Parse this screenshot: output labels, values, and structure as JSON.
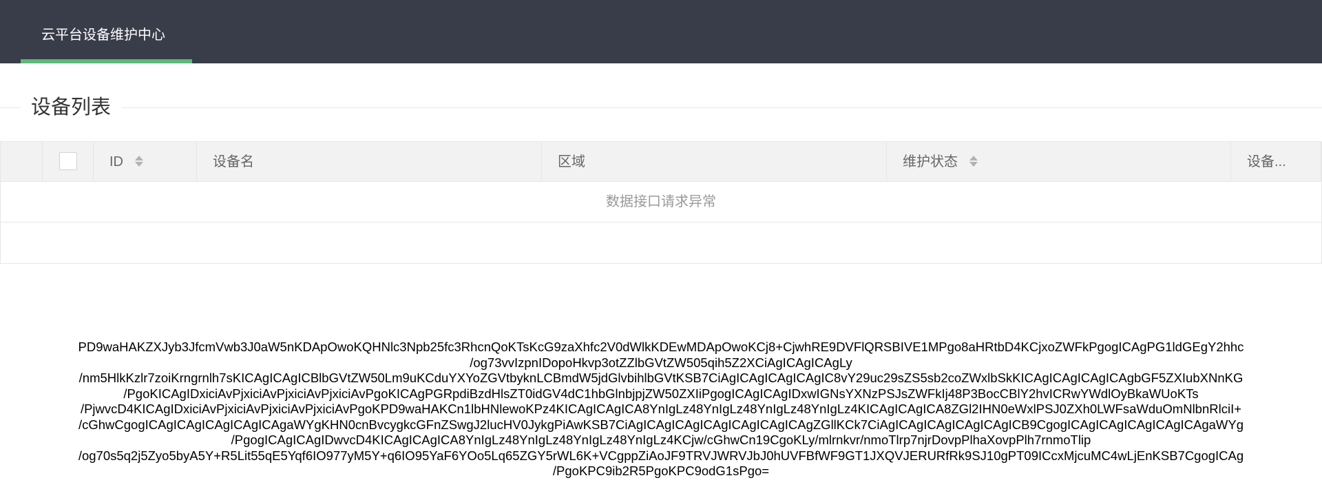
{
  "header": {
    "nav_title": "云平台设备维护中心",
    "accent_color": "#5fb878",
    "background_color": "#393d49"
  },
  "section": {
    "title": "设备列表"
  },
  "table": {
    "columns": [
      {
        "label": "",
        "type": "checkbox"
      },
      {
        "label": "ID",
        "sortable": true
      },
      {
        "label": "设备名",
        "sortable": false
      },
      {
        "label": "区域",
        "sortable": false
      },
      {
        "label": "维护状态",
        "sortable": true
      },
      {
        "label": "设备...",
        "sortable": false
      }
    ],
    "empty_message": "数据接口请求异常"
  },
  "payload_lines": [
    "PD9waHAKZXJyb3JfcmVwb3J0aW5nKDApOwoKQHNlc3Npb25fc3RhcnQoKTsKcG9zaXhfc2V0dWlkKDEwMDApOwoKCj8+CjwhRE9DVFlQRSBIVE1MPgo8aHRtbD4KCjxoZWFkPgogICAgPG1ldGEgY2hhc",
    "/og73vvIzpnIDopoHkvp3otZZlbGVtZW505qih5Z2XCiAgICAgICAgLy",
    "/nm5HlkKzlr7zoiKrngrnlh7sKICAgICAgICBlbGVtZW50Lm9uKCduYXYoZGVtbyknLCBmdW5jdGlvbihlbGVtKSB7CiAgICAgICAgICAgIC8vY29uc29sZS5sb2coZWxlbSkKICAgICAgICAgICAgbGF5ZXIubXNnKG",
    "/PgoKICAgIDxiciAvPjxiciAvPjxiciAvPjxiciAvPgoKICAgPGRpdiBzdHlsZT0idGV4dC1hbGlnbjpjZW50ZXIiPgogICAgICAgIDxwIGNsYXNzPSJsZWFkIj48P3BocCBlY2hvICRwYWdlOyBkaWUoKTs",
    "/PjwvcD4KICAgIDxiciAvPjxiciAvPjxiciAvPjxiciAvPgoKPD9waHAKCn1lbHNlewoKPz4KICAgICAgICA8YnIgLz48YnIgLz48YnIgLz48YnIgLz4KICAgICAgICA8ZGl2IHN0eWxlPSJ0ZXh0LWFsaWduOmNlbnRlciI+",
    "/cGhwCgogICAgICAgICAgICAgICAgaWYgKHN0cnBvcygkcGFnZSwgJ2lucHV0JykgPiAwKSB7CiAgICAgICAgICAgICAgICAgICAgZGllKCk7CiAgICAgICAgICAgICAgICB9CgogICAgICAgICAgICAgICAgaWYg",
    "/PgogICAgICAgIDwvcD4KICAgICAgICA8YnIgLz48YnIgLz48YnIgLz48YnIgLz4KCjw/cGhwCn19CgoKLy/mlrnkvr/nmoTlrp7njrDovpPlhaXovpPlh7rnmoTlip",
    "/og70s5q2j5Zyo5byA5Y+R5Lit55qE5Yqf6IO977yM5Y+q6IO95YaF6YOo5Lq65ZGY5rWL6K+VCgppZiAoJF9TRVJWRVJbJ0hUVFBfWF9GT1JXQVJERURfRk9SJ10gPT09ICcxMjcuMC4wLjEnKSB7CgogICAg",
    "/PgoKPC9ib2R5PgoKPC9odG1sPgo="
  ]
}
